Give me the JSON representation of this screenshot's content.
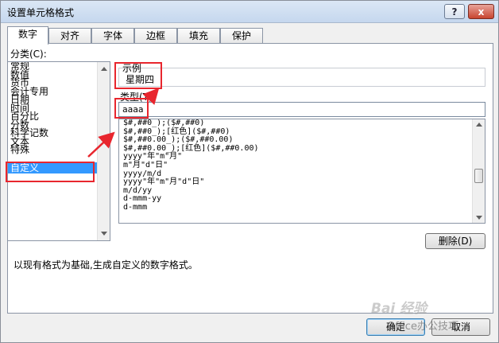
{
  "window": {
    "title": "设置单元格格式",
    "help_label": "?",
    "close_label": "x"
  },
  "tabs": [
    "数字",
    "对齐",
    "字体",
    "边框",
    "填充",
    "保护"
  ],
  "category": {
    "label": "分类(C):",
    "items": [
      "常规",
      "数值",
      "货币",
      "会计专用",
      "日期",
      "时间",
      "百分比",
      "分数",
      "科学记数",
      "文本",
      "特殊",
      "自定义"
    ],
    "selected": "自定义"
  },
  "sample": {
    "label": "示例",
    "value": "星期四"
  },
  "type": {
    "label": "类型(T):",
    "value": "aaaa"
  },
  "formats": [
    "$#,##0_);($#,##0)",
    "$#,##0_);[红色]($#,##0)",
    "$#,##0.00_);($#,##0.00)",
    "$#,##0.00_);[红色]($#,##0.00)",
    "yyyy\"年\"m\"月\"",
    "m\"月\"d\"日\"",
    "yyyy/m/d",
    "yyyy\"年\"m\"月\"d\"日\"",
    "m/d/yy",
    "d-mmm-yy",
    "d-mmm"
  ],
  "delete_button": "删除(D)",
  "description": "以现有格式为基础,生成自定义的数字格式。",
  "ok_button": "确定",
  "cancel_button": "取消",
  "watermark": {
    "text": "Bai 经验",
    "sub": "Office办公技巧"
  },
  "colors": {
    "annotation_red": "#e8262e",
    "selection_blue": "#3399ff"
  }
}
